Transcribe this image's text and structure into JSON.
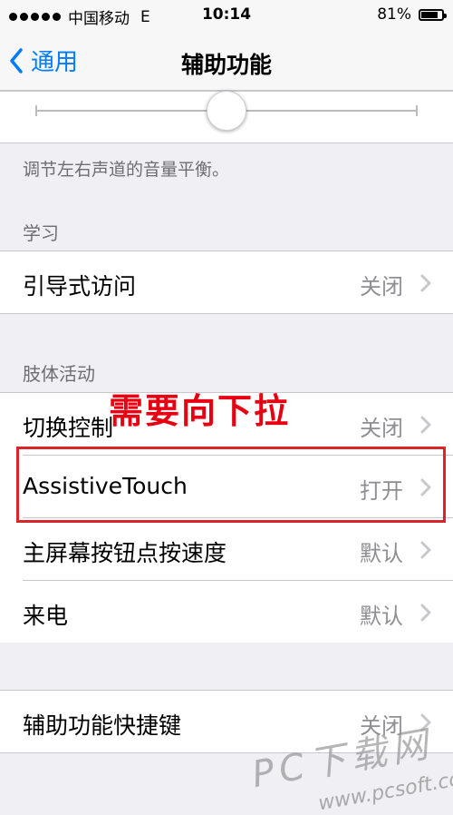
{
  "status_bar": {
    "carrier": "中国移动",
    "network": "E",
    "time": "10:14",
    "battery": "81%",
    "battery_level": 0.81
  },
  "nav": {
    "back_label": "通用",
    "title": "辅助功能"
  },
  "balance": {
    "footer": "调节左右声道的音量平衡。",
    "slider_value": 0.5
  },
  "sections": {
    "learning": {
      "header": "学习",
      "rows": [
        {
          "label": "引导式访问",
          "value": "关闭"
        }
      ]
    },
    "physical": {
      "header": "肢体活动",
      "rows": [
        {
          "label": "切换控制",
          "value": "关闭"
        },
        {
          "label": "AssistiveTouch",
          "value": "打开"
        },
        {
          "label": "主屏幕按钮点按速度",
          "value": "默认"
        },
        {
          "label": "来电",
          "value": "默认"
        }
      ]
    },
    "shortcut": {
      "rows": [
        {
          "label": "辅助功能快捷键",
          "value": "关闭"
        }
      ]
    }
  },
  "annotation": {
    "text": "需要向下拉",
    "color": "#e60012"
  },
  "watermark": {
    "text": "PC下载网",
    "url": "www.pcsoft.com.cn"
  },
  "colors": {
    "accent": "#007aff",
    "background": "#efeff4"
  }
}
